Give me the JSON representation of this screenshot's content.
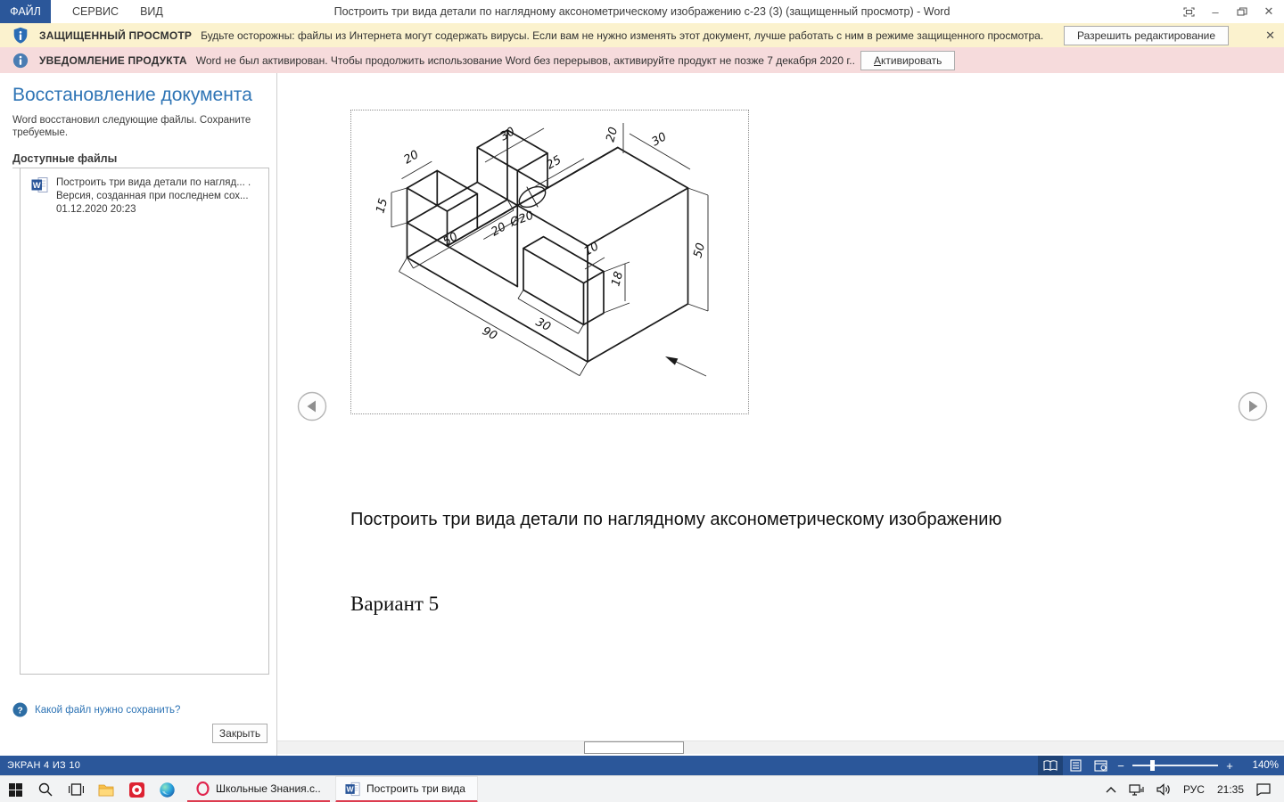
{
  "colors": {
    "accent": "#2b579a",
    "protected_banner": "#fbf2ce",
    "product_banner": "#f6dbdc",
    "taskbar_underline": "#dd3d50",
    "pane_title": "#2e74b5"
  },
  "title_bar": {
    "menus": [
      "ФАЙЛ",
      "СЕРВИС",
      "ВИД"
    ],
    "title": "Построить три вида детали по наглядному аксонометрическому изображению с-23 (3) (защищенный просмотр) - Word",
    "minimize": "–",
    "close": "✕"
  },
  "protected_banner": {
    "label": "ЗАЩИЩЕННЫЙ ПРОСМОТР",
    "message": "Будьте осторожны: файлы из Интернета могут содержать вирусы. Если вам не нужно изменять этот документ, лучше работать с ним в режиме защищенного просмотра.",
    "button": "Разрешить редактирование",
    "close": "✕"
  },
  "product_banner": {
    "label": "УВЕДОМЛЕНИЕ ПРОДУКТА",
    "message": "Word не был активирован. Чтобы продолжить использование Word без перерывов, активируйте продукт не позже 7 декабря 2020 г..",
    "button": "Активировать"
  },
  "recovery_pane": {
    "title": "Восстановление документа",
    "description": "Word восстановил следующие файлы.  Сохраните требуемые.",
    "section": "Доступные файлы",
    "file": {
      "line1": "Построить три вида детали по нагляд... .",
      "line2": "Версия, созданная при последнем сох...",
      "line3": "01.12.2020 20:23"
    },
    "help_link": "Какой файл нужно сохранить?",
    "close_button": "Закрыть"
  },
  "document": {
    "heading": "Построить три вида детали по наглядному аксонометрическому изображению",
    "variant": "Вариант 5",
    "drawing": {
      "labels": {
        "top_left_30": "30",
        "top_20": "20",
        "top_right_30": "30",
        "len_25": "25",
        "hole": "Ø20",
        "right_50": "50",
        "right_18": "18",
        "right_10": "10",
        "mid_30": "30",
        "bottom_90": "90",
        "left_20": "20",
        "left_15": "15",
        "slot_20": "20",
        "bottom_50": "50"
      }
    }
  },
  "status_bar": {
    "left": "ЭКРАН 4 ИЗ 10",
    "zoom_minus": "−",
    "zoom_plus": "+",
    "zoom": "140%"
  },
  "taskbar": {
    "buttons": [
      {
        "label": "Школьные Знания.с..."
      },
      {
        "label": "Построить три вида ..."
      }
    ],
    "tray": {
      "lang": "РУС",
      "time": "21:35"
    }
  }
}
